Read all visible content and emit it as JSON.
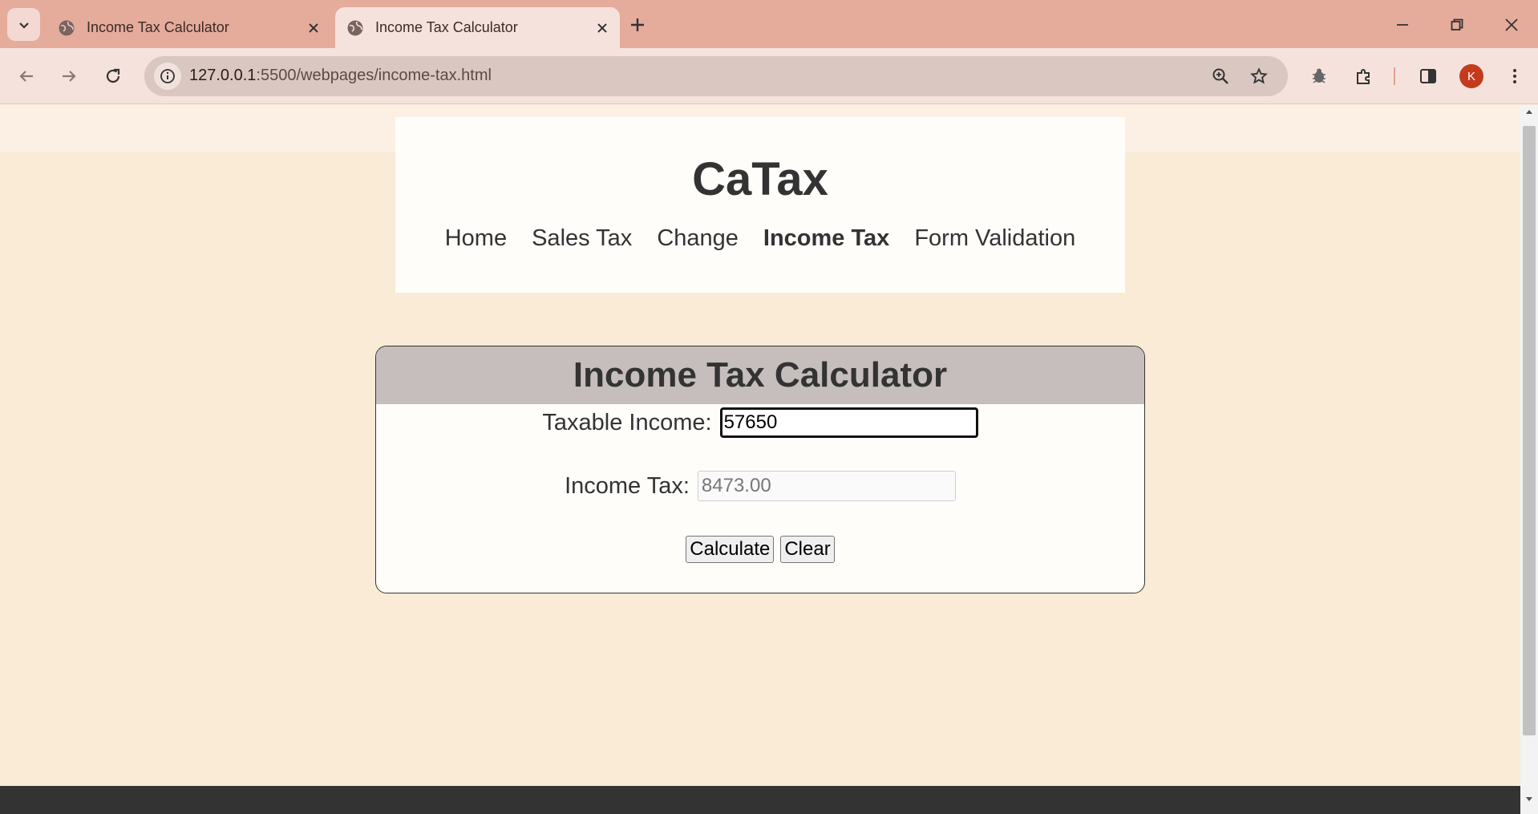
{
  "browser": {
    "tabs": [
      {
        "title": "Income Tax Calculator",
        "active": false
      },
      {
        "title": "Income Tax Calculator",
        "active": true
      }
    ],
    "url_host": "127.0.0.1",
    "url_path": ":5500/webpages/income-tax.html",
    "profile_initial": "K",
    "colors": {
      "frame": "#e5ab9b",
      "toolbar": "#f6e2dc",
      "omnibox": "#dac7c2",
      "avatar": "#c43a1d"
    }
  },
  "site": {
    "brand": "CaTax",
    "nav": [
      {
        "label": "Home",
        "current": false
      },
      {
        "label": "Sales Tax",
        "current": false
      },
      {
        "label": "Change",
        "current": false
      },
      {
        "label": "Income Tax",
        "current": true
      },
      {
        "label": "Form Validation",
        "current": false
      }
    ]
  },
  "calculator": {
    "heading": "Income Tax Calculator",
    "income_label": "Taxable Income:",
    "income_value": "57650",
    "tax_label": "Income Tax:",
    "tax_value": "8473.00",
    "calculate_label": "Calculate",
    "clear_label": "Clear"
  },
  "colors": {
    "page_bg": "#faebd7",
    "panel_header": "#c6bebd",
    "text": "#333333",
    "footer": "#333333"
  }
}
